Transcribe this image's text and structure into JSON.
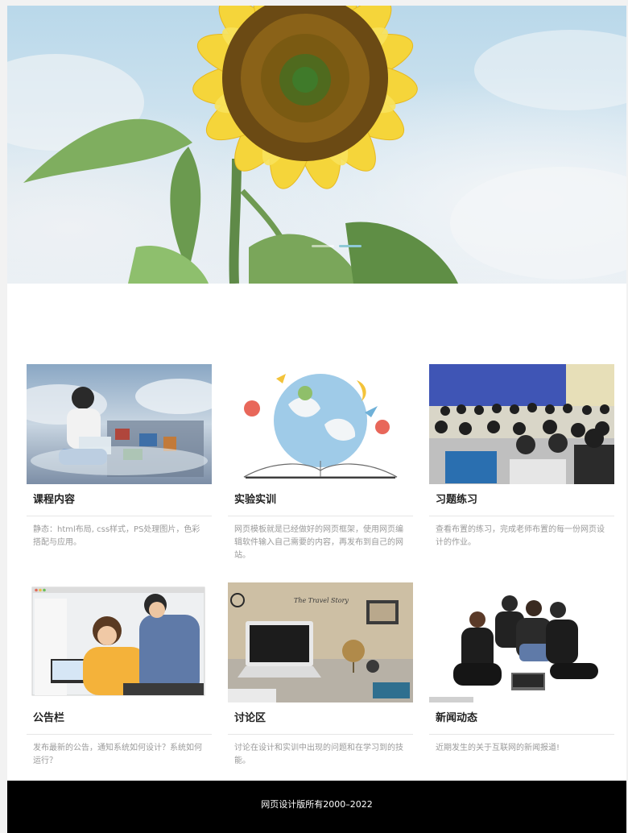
{
  "cards": [
    {
      "title": "课程内容",
      "desc": "静态：html布局, css样式，PS处理图片，色彩搭配与应用。",
      "image": "girl-reading-in-clouds"
    },
    {
      "title": "实验实训",
      "desc": "网页模板就是已经做好的网页框架，使用网页编辑软件输入自己需要的内容，再发布到自己的网站。",
      "image": "open-book-globe"
    },
    {
      "title": "习题练习",
      "desc": "查看布置的练习，完成老师布置的每一份网页设计的作业。",
      "image": "computer-classroom"
    },
    {
      "title": "公告栏",
      "desc": "发布最新的公告，通知系统如何设计？系统如何运行？",
      "image": "office-laptop-people"
    },
    {
      "title": "讨论区",
      "desc": "讨论在设计和实训中出现的问题和在学习到的技能。",
      "image": "laptop-desk-travel-story"
    },
    {
      "title": "新闻动态",
      "desc": "近期发生的关于互联网的新闻报道!",
      "image": "group-with-laptop"
    }
  ],
  "card_images_text": {
    "travel_story": "The Travel Story"
  },
  "footer": {
    "text": "网页设计版所有2000–2022"
  },
  "colors": {
    "footer_bg": "#000000",
    "accent_dot": "#8ec9d6"
  }
}
